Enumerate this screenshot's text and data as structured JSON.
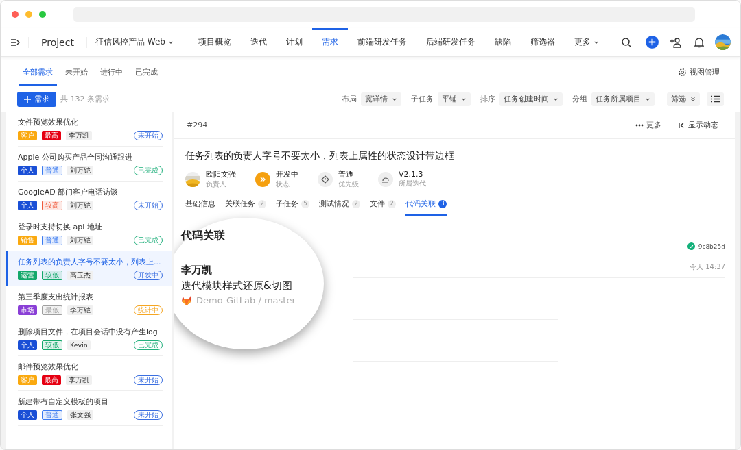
{
  "app_bar": {
    "project_label": "Project",
    "project_name": "征信风控产品 Web",
    "nav": [
      {
        "label": "项目概览",
        "selected": false
      },
      {
        "label": "迭代",
        "selected": false
      },
      {
        "label": "计划",
        "selected": false
      },
      {
        "label": "需求",
        "selected": true
      },
      {
        "label": "前端研发任务",
        "selected": false
      },
      {
        "label": "后端研发任务",
        "selected": false
      },
      {
        "label": "缺陷",
        "selected": false
      },
      {
        "label": "筛选器",
        "selected": false
      }
    ],
    "more": "更多"
  },
  "sub_tabs": [
    {
      "label": "全部需求",
      "selected": true
    },
    {
      "label": "未开始",
      "selected": false
    },
    {
      "label": "进行中",
      "selected": false
    },
    {
      "label": "已完成",
      "selected": false
    }
  ],
  "view_manage": "视图管理",
  "toolbar": {
    "new_button": "需求",
    "count": "共 132 条需求",
    "options": [
      {
        "label": "布局",
        "value": "宽详情"
      },
      {
        "label": "子任务",
        "value": "平铺"
      },
      {
        "label": "排序",
        "value": "任务创建时间"
      },
      {
        "label": "分组",
        "value": "任务所属项目"
      }
    ],
    "filter": "筛选"
  },
  "items": [
    {
      "title": "文件预览效果优化",
      "type": {
        "text": "客户",
        "color": "#faa90f"
      },
      "priority": {
        "text": "最高",
        "color": "#e60012",
        "solid": true
      },
      "owner": "李万凯",
      "status": {
        "text": "未开始",
        "color": "#3b6fe0"
      },
      "selected": false
    },
    {
      "title": "Apple 公司购买产品合同沟通跟进",
      "type": {
        "text": "个人",
        "color": "#1a4fd6"
      },
      "priority": {
        "text": "普通",
        "color": "#3b7bf0",
        "solid": false
      },
      "owner": "刘万铠",
      "status": {
        "text": "已完成",
        "color": "#22b07d"
      },
      "selected": false
    },
    {
      "title": "GoogleAD 部门客户电话访谈",
      "type": {
        "text": "个人",
        "color": "#1a4fd6"
      },
      "priority": {
        "text": "较高",
        "color": "#f05a3c",
        "solid": false
      },
      "owner": "刘万铠",
      "status": {
        "text": "未开始",
        "color": "#3b6fe0"
      },
      "selected": false
    },
    {
      "title": "登录时支持切换 api 地址",
      "type": {
        "text": "销售",
        "color": "#faa90f"
      },
      "priority": {
        "text": "普通",
        "color": "#3b7bf0",
        "solid": false
      },
      "owner": "刘万铠",
      "status": {
        "text": "已完成",
        "color": "#22b07d"
      },
      "selected": false
    },
    {
      "title": "任务列表的负责人字号不要太小，列表上...",
      "type": {
        "text": "运营",
        "color": "#13a86b"
      },
      "priority": {
        "text": "较低",
        "color": "#13a86b",
        "solid": false
      },
      "owner": "高玉杰",
      "status": {
        "text": "开发中",
        "color": "#3b6fe0"
      },
      "selected": true
    },
    {
      "title": "第三季度支出统计报表",
      "type": {
        "text": "市场",
        "color": "#8a3fd6"
      },
      "priority": {
        "text": "最低",
        "color": "#a0a0a0",
        "solid": false
      },
      "owner": "李万铠",
      "status": {
        "text": "统计中",
        "color": "#f5a623"
      },
      "selected": false
    },
    {
      "title": "删除项目文件，在项目会话中没有产生log",
      "type": {
        "text": "个人",
        "color": "#1a4fd6"
      },
      "priority": {
        "text": "较低",
        "color": "#13a86b",
        "solid": false
      },
      "owner": "Kevin",
      "status": {
        "text": "已完成",
        "color": "#22b07d"
      },
      "selected": false
    },
    {
      "title": "邮件预览效果优化",
      "type": {
        "text": "客户",
        "color": "#faa90f"
      },
      "priority": {
        "text": "最高",
        "color": "#e60012",
        "solid": true
      },
      "owner": "李万凯",
      "status": {
        "text": "未开始",
        "color": "#3b6fe0"
      },
      "selected": false
    },
    {
      "title": "新建带有自定义模板的项目",
      "type": {
        "text": "个人",
        "color": "#1a4fd6"
      },
      "priority": {
        "text": "普通",
        "color": "#3b7bf0",
        "solid": false
      },
      "owner": "张文强",
      "status": {
        "text": "未开始",
        "color": "#3b6fe0"
      },
      "selected": false
    }
  ],
  "detail": {
    "id": "#294",
    "more": "更多",
    "show_activity": "显示动态",
    "title": "任务列表的负责人字号不要太小，列表上属性的状态设计带边框",
    "meta": [
      {
        "kind": "avatar",
        "value": "欧阳文强",
        "label": "负责人"
      },
      {
        "kind": "status",
        "value": "开发中",
        "label": "状态"
      },
      {
        "kind": "priority",
        "value": "普通",
        "label": "优先级"
      },
      {
        "kind": "iteration",
        "value": "V2.1.3",
        "label": "所属迭代"
      }
    ],
    "tabs": [
      {
        "label": "基础信息",
        "selected": false
      },
      {
        "label": "关联任务",
        "count": "2",
        "selected": false
      },
      {
        "label": "子任务",
        "count": "5",
        "selected": false
      },
      {
        "label": "测试情况",
        "count": "2",
        "selected": false
      },
      {
        "label": "文件",
        "count": "2",
        "selected": false
      },
      {
        "label": "代码关联",
        "count": "3",
        "selected": true
      }
    ],
    "code": {
      "heading": "代码关联",
      "author": "李万凯",
      "message": "迭代模块样式还原&切图",
      "repo": "Demo-GitLab / master",
      "hash": "9c8b25d",
      "time": "今天 14:37"
    }
  }
}
